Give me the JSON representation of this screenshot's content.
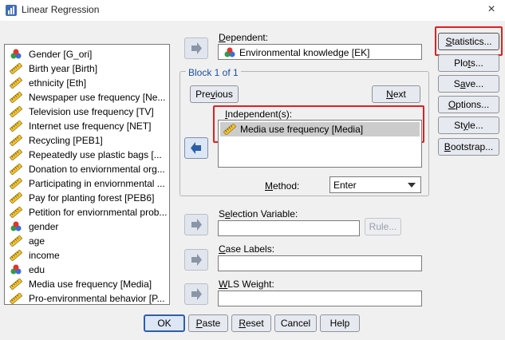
{
  "window": {
    "title": "Linear Regression",
    "close": "×"
  },
  "variables": [
    {
      "label": "Gender [G_ori]",
      "icon": "nominal-icon"
    },
    {
      "label": "Birth year [Birth]",
      "icon": "scale-ruler-icon"
    },
    {
      "label": "ethnicity [Eth]",
      "icon": "scale-ruler-icon"
    },
    {
      "label": "Newspaper use frequency [Ne...",
      "icon": "scale-ruler-icon"
    },
    {
      "label": "Television use frequency [TV]",
      "icon": "scale-ruler-icon"
    },
    {
      "label": "Internet use frequency [NET]",
      "icon": "scale-ruler-icon"
    },
    {
      "label": "Recycling [PEB1]",
      "icon": "scale-ruler-icon"
    },
    {
      "label": "Repeatedly use plastic bags [...",
      "icon": "scale-ruler-icon"
    },
    {
      "label": "Donation to enviornmental org...",
      "icon": "scale-ruler-icon"
    },
    {
      "label": "Participating in enviornmental ...",
      "icon": "scale-ruler-icon"
    },
    {
      "label": "Pay for planting forest [PEB6]",
      "icon": "scale-ruler-icon"
    },
    {
      "label": "Petition for enviornmental prob...",
      "icon": "scale-ruler-icon"
    },
    {
      "label": "gender",
      "icon": "nominal-icon"
    },
    {
      "label": "age",
      "icon": "scale-ruler-icon"
    },
    {
      "label": "income",
      "icon": "scale-ruler-icon"
    },
    {
      "label": "edu",
      "icon": "nominal-icon"
    },
    {
      "label": "Media use frequency [Media]",
      "icon": "scale-ruler-icon"
    },
    {
      "label": "Pro-environmental behavior [P...",
      "icon": "scale-ruler-icon"
    }
  ],
  "dependent": {
    "label": "Dependent:",
    "value": "Environmental knowledge [EK]"
  },
  "block": {
    "label": "Block 1 of 1",
    "previous": "Previous",
    "next": "Next"
  },
  "independents": {
    "label": "Independent(s):",
    "items": [
      "Media use frequency [Media]"
    ]
  },
  "method": {
    "label": "Method:",
    "value": "Enter"
  },
  "selection": {
    "label": "Selection Variable:",
    "rule": "Rule..."
  },
  "case_labels": {
    "label": "Case Labels:"
  },
  "wls": {
    "label": "WLS Weight:"
  },
  "side_buttons": [
    "Statistics...",
    "Plots...",
    "Save...",
    "Options...",
    "Style...",
    "Bootstrap..."
  ],
  "bottom_buttons": [
    "OK",
    "Paste",
    "Reset",
    "Cancel",
    "Help"
  ],
  "colors": {
    "highlight": "#e02020",
    "accent": "#2c5fa8",
    "selected_row": "#cccccc"
  }
}
